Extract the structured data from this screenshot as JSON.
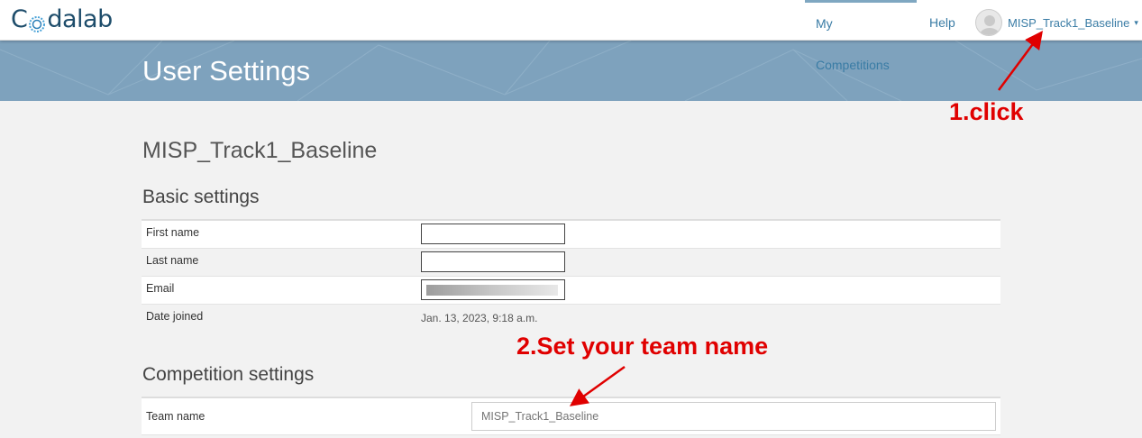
{
  "app": {
    "logo_text_left": "C",
    "logo_text_right": "dalab",
    "logo_full": "CodaLab"
  },
  "nav": {
    "my_competitions": "My Competitions",
    "help": "Help",
    "user_name": "MISP_Track1_Baseline",
    "caret": "▾"
  },
  "banner": {
    "title": "User Settings"
  },
  "profile": {
    "name": "MISP_Track1_Baseline"
  },
  "basic_settings": {
    "title": "Basic settings",
    "rows": [
      {
        "label": "First name",
        "value": ""
      },
      {
        "label": "Last name",
        "value": ""
      },
      {
        "label": "Email",
        "value": ""
      },
      {
        "label": "Date joined",
        "value": "Jan. 13, 2023, 9:18 a.m."
      }
    ]
  },
  "competition_settings": {
    "title": "Competition settings",
    "team_name_label": "Team name",
    "team_name_placeholder": "MISP_Track1_Baseline"
  },
  "annotations": {
    "step1": "1.click",
    "step2": "2.Set your team name",
    "color": "#e00000"
  },
  "colors": {
    "banner": "#7ea2bd",
    "link": "#3a7ca5",
    "logo": "#1e4d6b"
  }
}
